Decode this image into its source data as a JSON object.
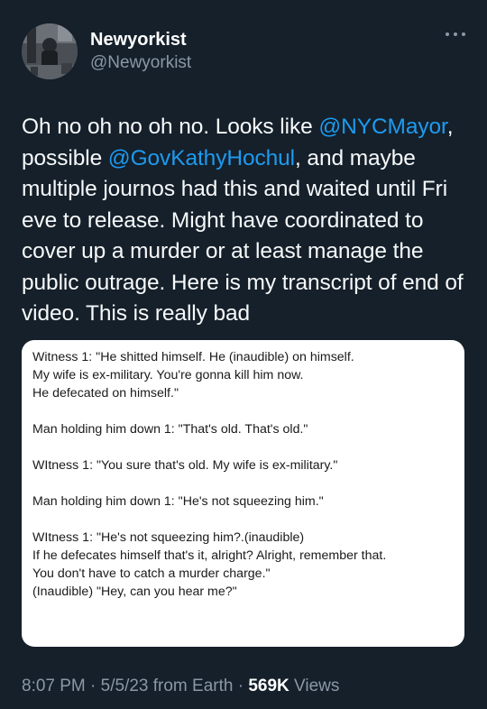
{
  "author": {
    "display_name": "Newyorkist",
    "handle": "@Newyorkist",
    "more_icon": "more-horizontal-icon"
  },
  "tweet": {
    "segments": [
      {
        "text": "Oh no oh no oh no. Looks like ",
        "type": "text"
      },
      {
        "text": "@NYCMayor",
        "type": "mention"
      },
      {
        "text": ", possible ",
        "type": "text"
      },
      {
        "text": "@GovKathyHochul",
        "type": "mention"
      },
      {
        "text": ", and maybe multiple journos had this and waited until Fri eve to release. Might have coordinated to cover up a murder or at least manage the public outrage. Here is my transcript of end of video. This is really bad",
        "type": "text"
      }
    ]
  },
  "transcript": {
    "paragraphs": [
      [
        "Witness 1: \"He shitted himself. He (inaudible) on himself.",
        "My wife is ex-military. You're gonna kill him now.",
        "He defecated on himself.\""
      ],
      [
        "Man holding him down 1: \"That's old. That's old.\""
      ],
      [
        "WItness 1: \"You sure that's old. My wife is ex-military.\""
      ],
      [
        "Man holding him down 1: \"He's not squeezing him.\""
      ],
      [
        "WItness 1: \"He's not squeezing him?.(inaudible)",
        "If he defecates himself that's it, alright? Alright, remember that.",
        "You don't have to catch a murder charge.\"",
        "(Inaudible) \"Hey, can you hear me?\""
      ]
    ]
  },
  "meta": {
    "time": "8:07 PM",
    "sep1": " · ",
    "date": "5/5/23",
    "source": " from Earth",
    "sep2": " · ",
    "views_count": "569K",
    "views_label": " Views"
  }
}
